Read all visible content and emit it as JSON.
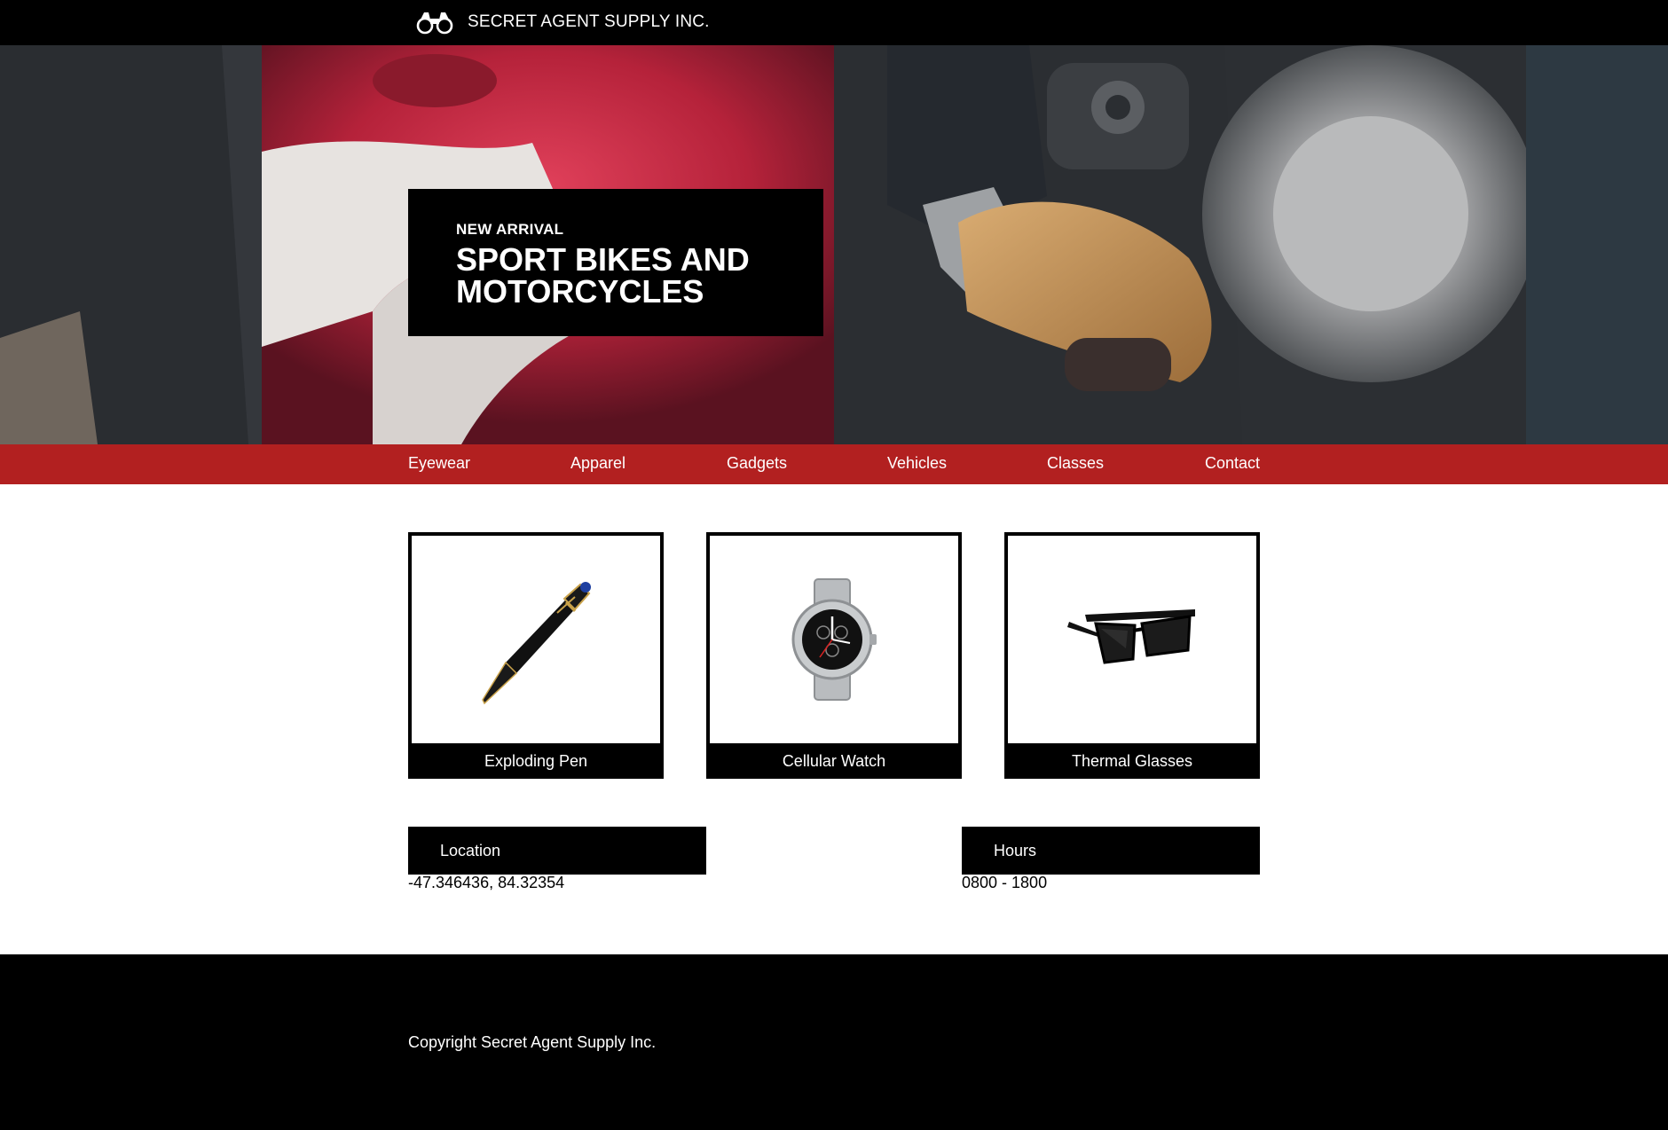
{
  "header": {
    "brand_name": "SECRET AGENT SUPPLY INC.",
    "logo_icon": "binoculars-icon"
  },
  "hero": {
    "kicker": "NEW ARRIVAL",
    "title": "SPORT BIKES AND MOTORCYCLES"
  },
  "nav": {
    "items": [
      {
        "label": "Eyewear"
      },
      {
        "label": "Apparel"
      },
      {
        "label": "Gadgets"
      },
      {
        "label": "Vehicles"
      },
      {
        "label": "Classes"
      },
      {
        "label": "Contact"
      }
    ]
  },
  "products": [
    {
      "label": "Exploding Pen",
      "icon": "pen-icon"
    },
    {
      "label": "Cellular Watch",
      "icon": "watch-icon"
    },
    {
      "label": "Thermal Glasses",
      "icon": "sunglasses-icon"
    }
  ],
  "info": {
    "location_title": "Location",
    "location_value": "-47.346436, 84.32354",
    "hours_title": "Hours",
    "hours_value": "0800 - 1800"
  },
  "footer": {
    "copyright": "Copyright Secret Agent Supply Inc."
  },
  "colors": {
    "nav_red": "#b22020",
    "dark": "#000000",
    "light": "#ffffff"
  }
}
